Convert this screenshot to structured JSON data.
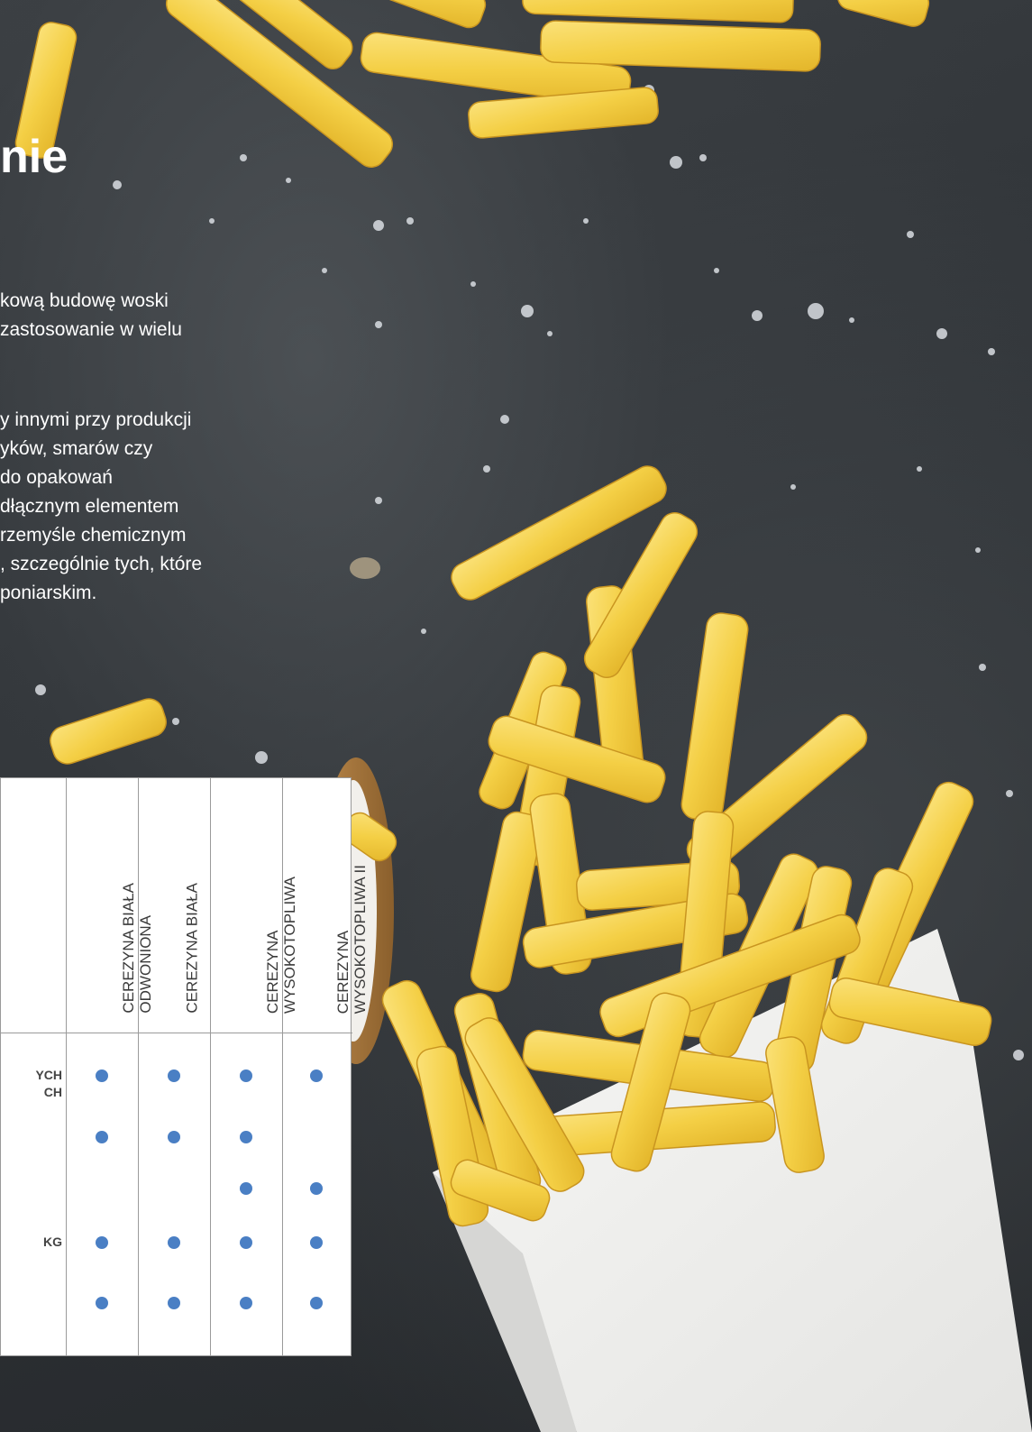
{
  "heading": "nie",
  "paragraph1": [
    "kową budowę woski",
    "zastosowanie w wielu"
  ],
  "paragraph2": [
    "y innymi przy produkcji",
    "yków, smarów czy",
    "do opakowań",
    "dłącznym elementem",
    "rzemyśle chemicznym",
    ", szczególnie tych, które",
    "poniarskim."
  ],
  "table": {
    "columns": [
      "CEREZYNA BIAŁA\nODWONIONA",
      "CEREZYNA BIAŁA",
      "CEREZYNA\nWYSOKOTOPLIWA",
      "CEREZYNA\nWYSOKOTOPLIWA II"
    ],
    "rows": [
      {
        "label": "YCH\nCH",
        "marks": [
          true,
          true,
          true,
          true
        ]
      },
      {
        "label": "",
        "marks": [
          true,
          true,
          true,
          false
        ]
      },
      {
        "label": "",
        "marks": [
          false,
          false,
          true,
          true
        ]
      },
      {
        "label": "KG",
        "marks": [
          true,
          true,
          true,
          true
        ]
      },
      {
        "label": "",
        "marks": [
          true,
          true,
          true,
          true
        ]
      }
    ]
  },
  "colors": {
    "dot": "#4a7fc4",
    "table_border": "#9a9a9a",
    "background": "#2f3337",
    "fries": "#f6d45a"
  }
}
